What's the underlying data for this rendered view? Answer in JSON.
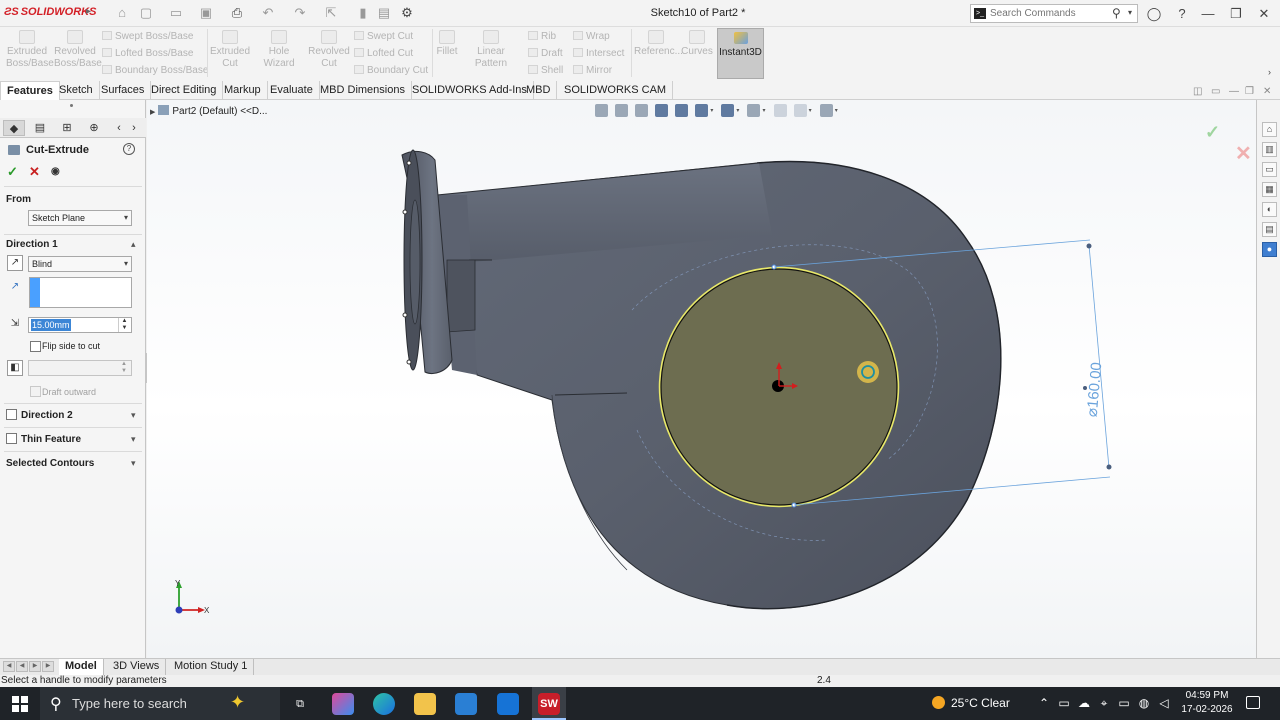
{
  "app": {
    "logo_text": "SOLIDWORKS",
    "title": "Sketch10 of Part2 *",
    "search_placeholder": "Search Commands"
  },
  "command_manager": {
    "extruded_boss": "Extruded Boss/Base",
    "revolved_boss": "Revolved Boss/Base",
    "swept_boss": "Swept Boss/Base",
    "lofted_boss": "Lofted Boss/Base",
    "boundary_boss": "Boundary Boss/Base",
    "extruded_cut": "Extruded Cut",
    "hole_wizard": "Hole Wizard",
    "revolved_cut": "Revolved Cut",
    "swept_cut": "Swept Cut",
    "lofted_cut": "Lofted Cut",
    "boundary_cut": "Boundary Cut",
    "fillet": "Fillet",
    "linear_pattern": "Linear Pattern",
    "rib": "Rib",
    "draft": "Draft",
    "shell": "Shell",
    "wrap": "Wrap",
    "intersect": "Intersect",
    "mirror": "Mirror",
    "reference": "Referenc...",
    "curves": "Curves",
    "instant3d": "Instant3D"
  },
  "tabs": [
    "Features",
    "Sketch",
    "Surfaces",
    "Direct Editing",
    "Markup",
    "Evaluate",
    "MBD Dimensions",
    "SOLIDWORKS Add-Ins",
    "MBD",
    "SOLIDWORKS CAM"
  ],
  "property_manager": {
    "title": "Cut-Extrude",
    "from_label": "From",
    "from_value": "Sketch Plane",
    "direction1_label": "Direction 1",
    "end_condition": "Blind",
    "depth": "15.00mm",
    "flip_side": "Flip side to cut",
    "draft_outward": "Draft outward",
    "direction2_label": "Direction 2",
    "thin_feature_label": "Thin Feature",
    "selected_contours_label": "Selected Contours"
  },
  "viewport": {
    "tree_path": "Part2 (Default) <<D...",
    "dimension": "⌀160.00",
    "axis_x": "X",
    "axis_y": "Y"
  },
  "bottom_tabs": [
    "Model",
    "3D Views",
    "Motion Study 1"
  ],
  "status": {
    "message": "Select a handle to modify parameters",
    "value": "2.4"
  },
  "taskbar": {
    "search_placeholder": "Type here to search",
    "weather": "25°C  Clear",
    "time": "04:59 PM",
    "date": "17-02-2026"
  }
}
